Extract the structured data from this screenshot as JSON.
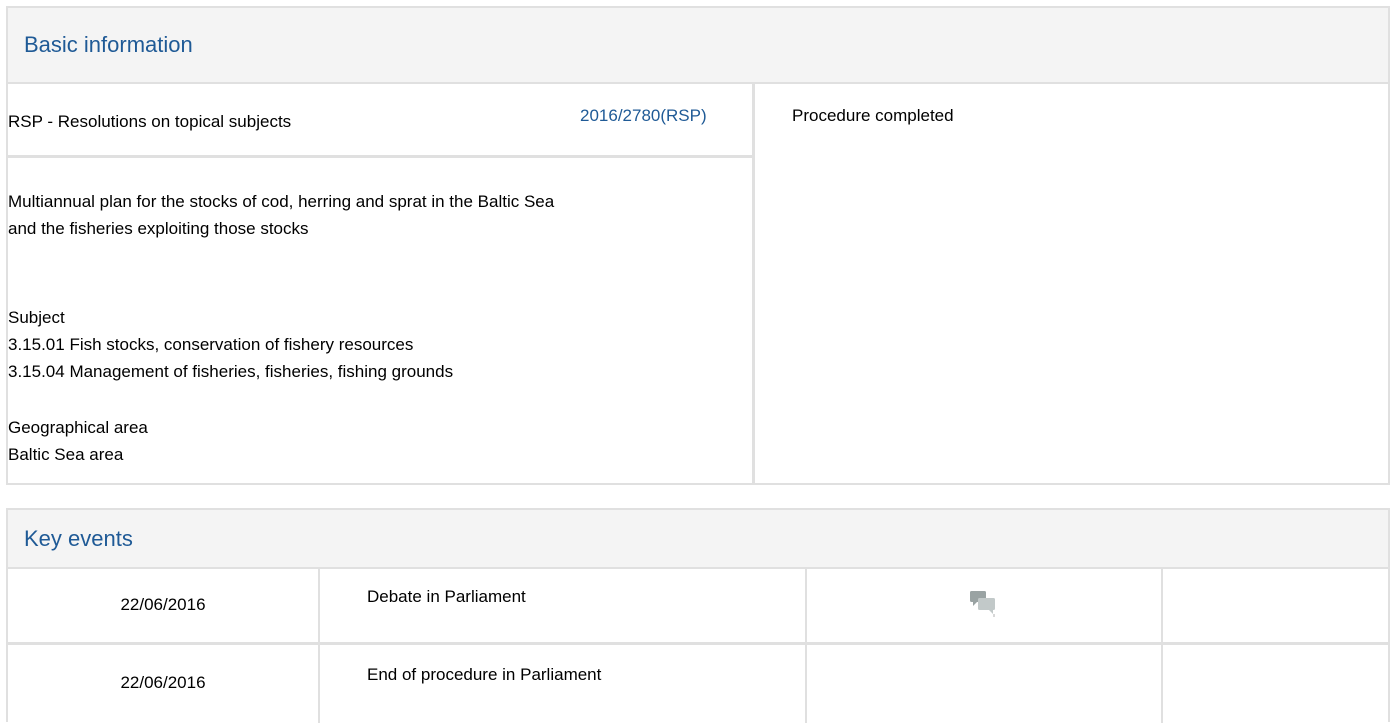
{
  "basic_info": {
    "heading": "Basic information",
    "procedure_type": "RSP - Resolutions on topical subjects",
    "reference": "2016/2780(RSP)",
    "status": "Procedure completed",
    "title_lines": [
      "Multiannual plan for the stocks of cod, herring and sprat in the Baltic Sea",
      "and the fisheries exploiting those stocks"
    ],
    "subject": {
      "label": "Subject",
      "items": [
        "3.15.01 Fish stocks, conservation of fishery resources",
        "3.15.04 Management of fisheries, fisheries, fishing grounds"
      ]
    },
    "geo": {
      "label": "Geographical area",
      "value": "Baltic Sea area"
    }
  },
  "key_events": {
    "heading": "Key events",
    "rows": [
      {
        "date": "22/06/2016",
        "event": "Debate in Parliament",
        "icon": "debate-speech-bubbles-icon"
      },
      {
        "date": "22/06/2016",
        "event": "End of procedure in Parliament",
        "icon": ""
      }
    ]
  },
  "colors": {
    "link": "#1f5a96",
    "border": "#e0e0e0",
    "header_bg": "#f4f4f4"
  }
}
